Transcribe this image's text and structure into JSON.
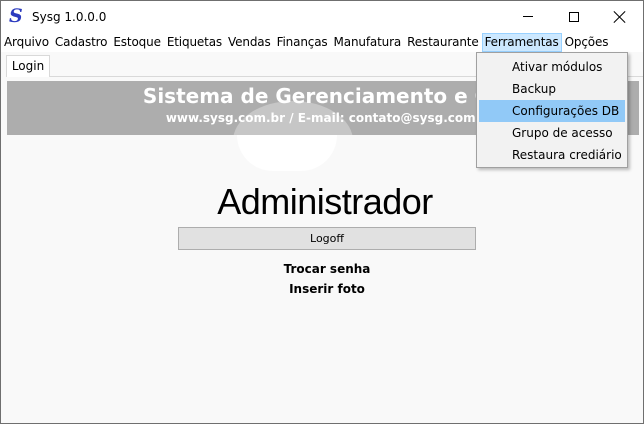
{
  "window": {
    "logo_letter": "S",
    "title": "Sysg 1.0.0.0"
  },
  "menubar": {
    "items": [
      {
        "label": "Arquivo"
      },
      {
        "label": "Cadastro"
      },
      {
        "label": "Estoque"
      },
      {
        "label": "Etiquetas"
      },
      {
        "label": "Vendas"
      },
      {
        "label": "Finanças"
      },
      {
        "label": "Manufatura"
      },
      {
        "label": "Restaurante"
      },
      {
        "label": "Ferramentas",
        "active": true
      },
      {
        "label": "Opções"
      }
    ]
  },
  "dropdown": {
    "items": [
      {
        "label": "Ativar módulos"
      },
      {
        "label": "Backup"
      },
      {
        "label": "Configurações DB",
        "highlighted": true
      },
      {
        "label": "Grupo de acesso"
      },
      {
        "label": "Restaura crediário"
      }
    ]
  },
  "tabs": [
    {
      "label": "Login",
      "selected": true
    }
  ],
  "banner": {
    "title": "Sistema de Gerenciamento e Co",
    "subtitle": "www.sysg.com.br / E-mail: contato@sysg.com."
  },
  "main": {
    "user_name": "Administrador",
    "logoff_label": "Logoff",
    "change_password_label": "Trocar senha",
    "insert_photo_label": "Inserir foto"
  },
  "colors": {
    "logo": "#2c3bbf",
    "banner_bg": "#adadad",
    "menu_active_bg": "#cce8ff",
    "dropdown_highlight": "#91c9f7"
  }
}
